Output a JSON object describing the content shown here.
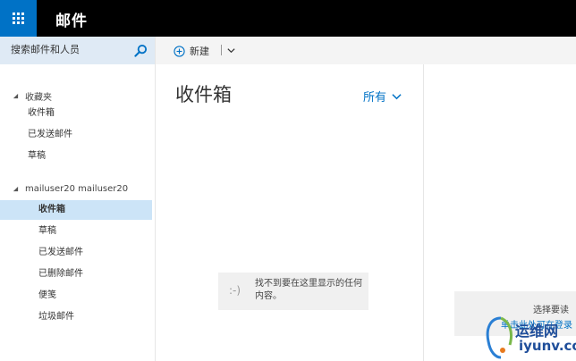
{
  "app": {
    "title": "邮件"
  },
  "search": {
    "placeholder": "搜索邮件和人员"
  },
  "command": {
    "new_label": "新建"
  },
  "nav": {
    "favorites": {
      "header": "收藏夹",
      "items": [
        "收件箱",
        "已发送邮件",
        "草稿"
      ]
    },
    "account": {
      "header": "mailuser20 mailuser20",
      "items": [
        "收件箱",
        "草稿",
        "已发送邮件",
        "已删除邮件",
        "便笺",
        "垃圾邮件"
      ],
      "selected": "收件箱"
    }
  },
  "list": {
    "folder_title": "收件箱",
    "filter_label": "所有",
    "empty_face": ":-)",
    "empty_message": "找不到要在这里显示的任何内容。"
  },
  "reading": {
    "prompt": "选择要读",
    "link": "单击此处可在登录"
  },
  "watermark": {
    "cn": "运维网",
    "en": "iyunv.com"
  },
  "colors": {
    "brand_blue": "#0072c6",
    "topbar": "#000000",
    "search_bg": "#dfeaf5",
    "selected_bg": "#cce4f7",
    "commandbar_bg": "#f4f4f4"
  }
}
